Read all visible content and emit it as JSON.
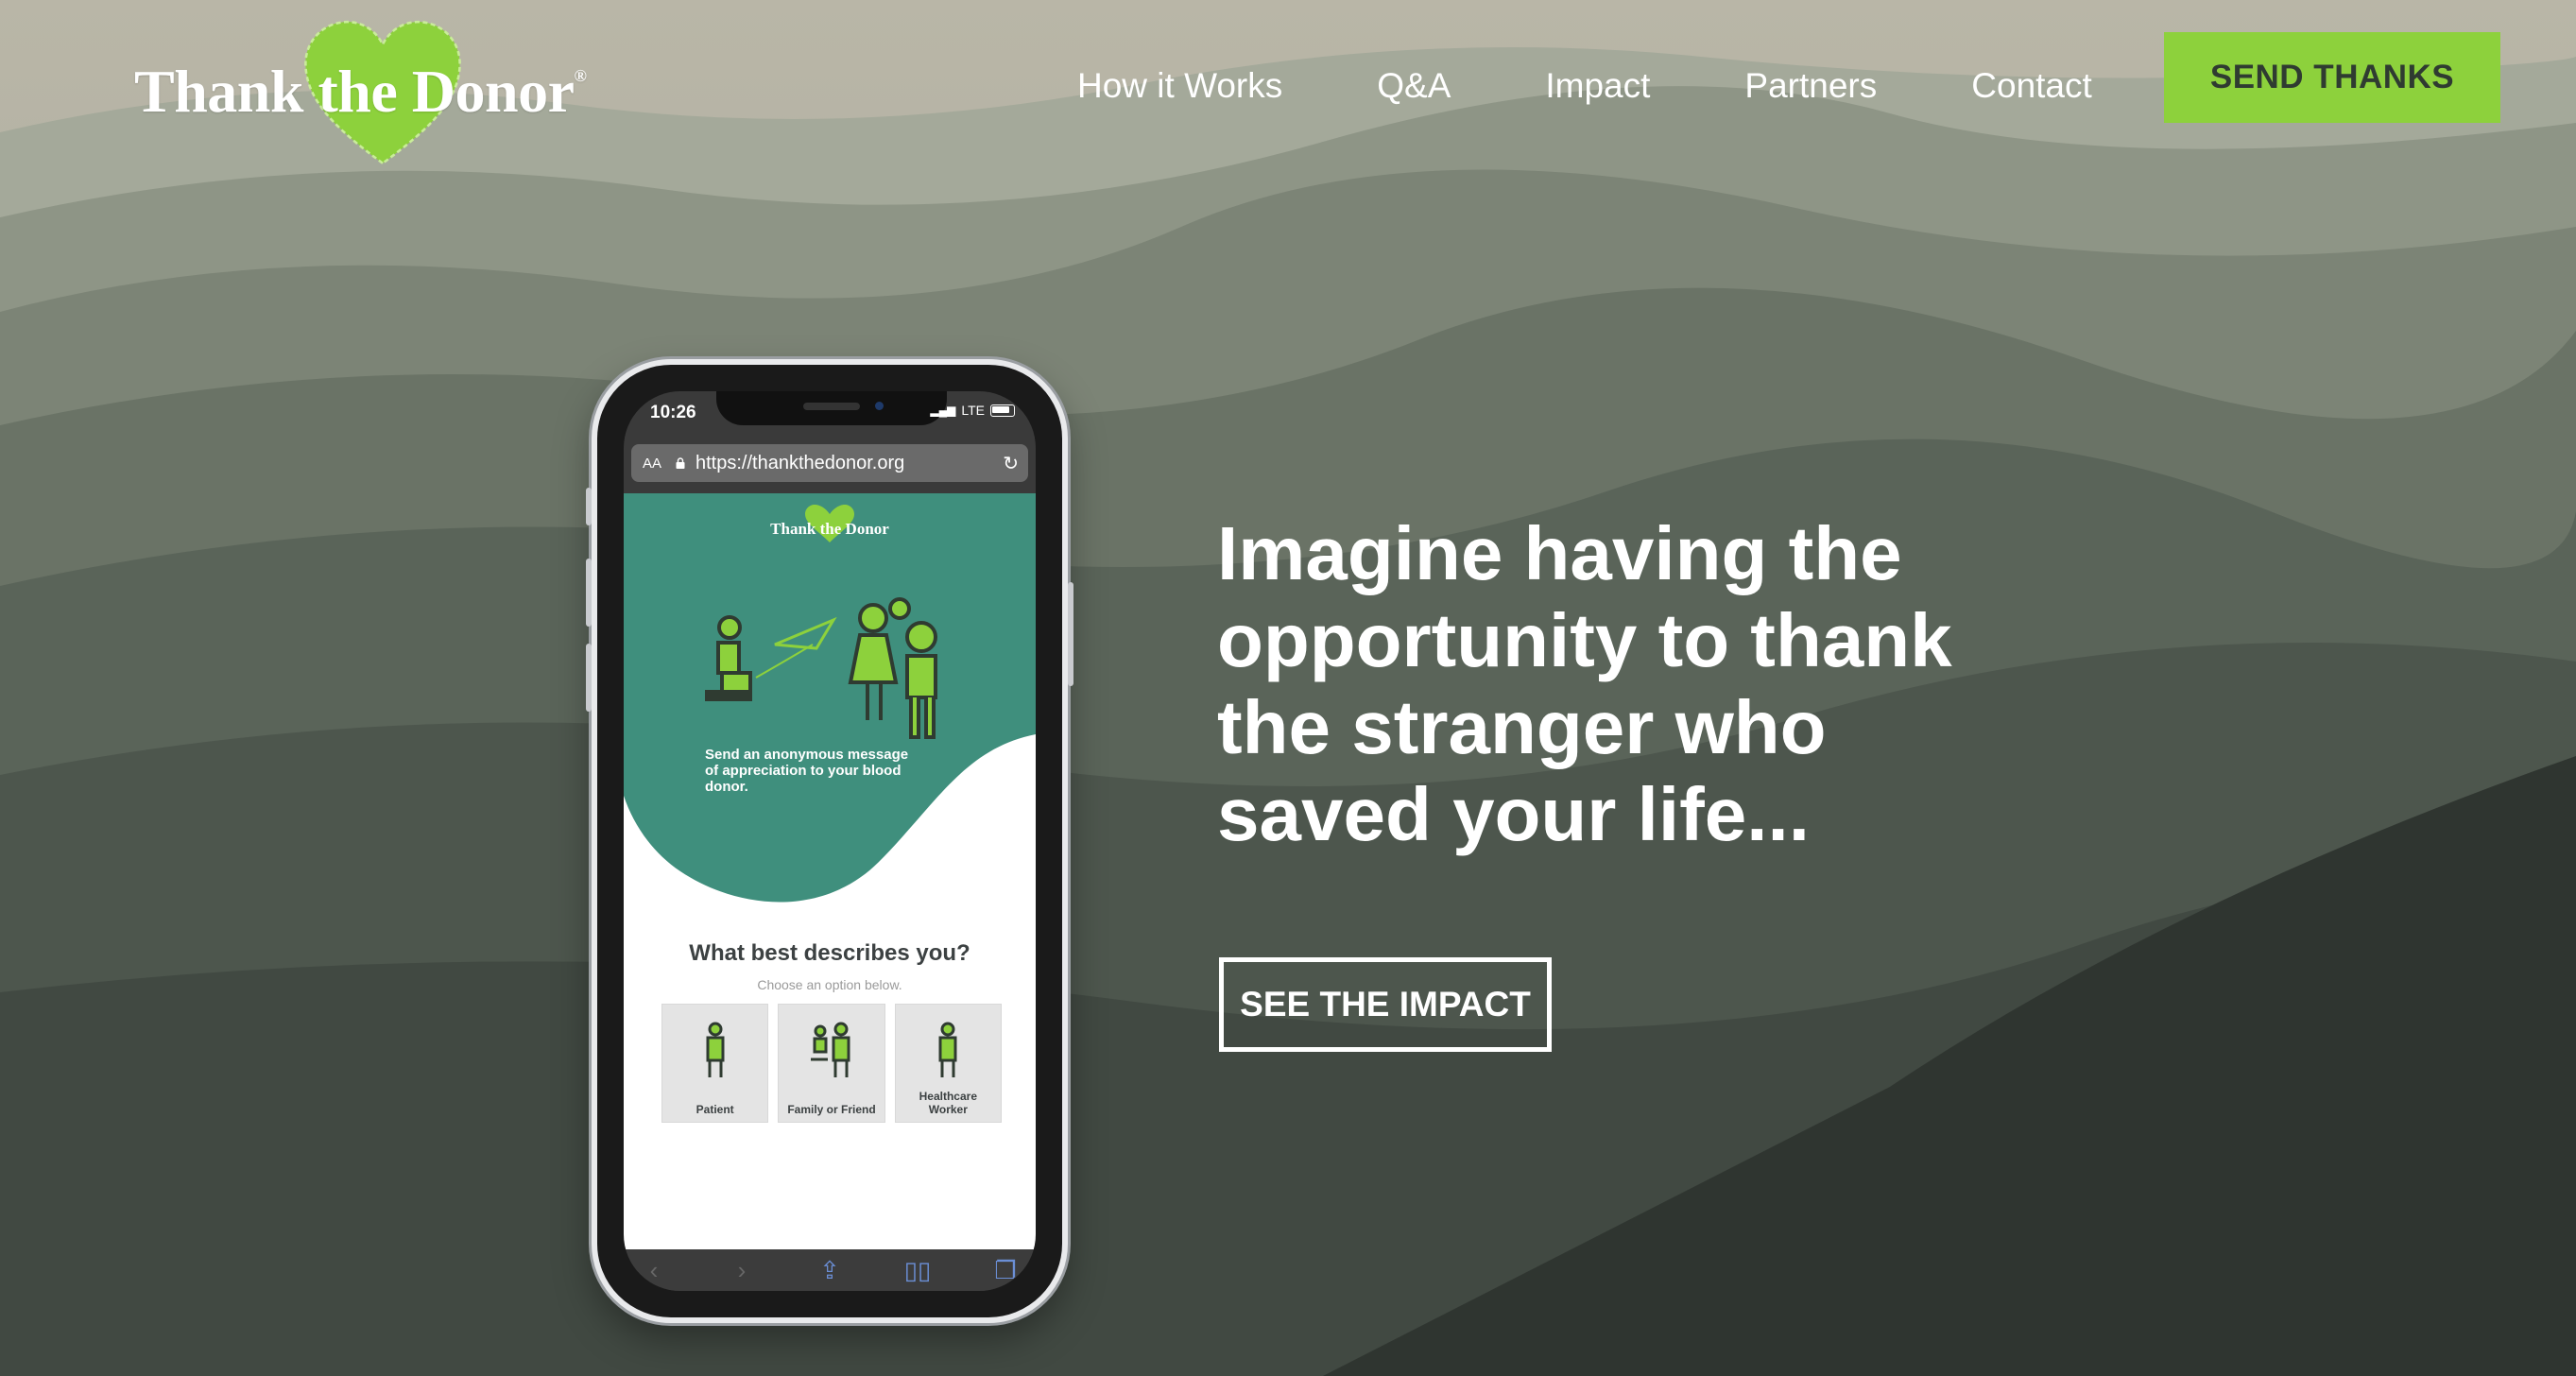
{
  "logo": {
    "text": "Thank the Donor",
    "trademark": "®"
  },
  "nav": {
    "items": [
      {
        "label": "How it Works"
      },
      {
        "label": "Q&A"
      },
      {
        "label": "Impact"
      },
      {
        "label": "Partners"
      },
      {
        "label": "Contact"
      }
    ]
  },
  "header": {
    "send_thanks_label": "SEND THANKS"
  },
  "hero": {
    "headline": "Imagine having the opportunity to thank the stranger who saved your life...",
    "cta_label": "SEE THE IMPACT"
  },
  "phone": {
    "time": "10:26",
    "network": "LTE",
    "url_aa": "AA",
    "url": "https://thankthedonor.org",
    "site": {
      "logo_text": "Thank the Donor",
      "tagline": "Send an anonymous message of appreciation to your blood donor.",
      "question_title": "What best describes you?",
      "question_subtitle": "Choose an option below.",
      "options": [
        {
          "label": "Patient"
        },
        {
          "label": "Family or Friend"
        },
        {
          "label": "Healthcare Worker"
        }
      ]
    }
  },
  "colors": {
    "accent_green": "#8dd13c",
    "teal": "#3f8f7d",
    "button_text": "#2f3b31"
  }
}
